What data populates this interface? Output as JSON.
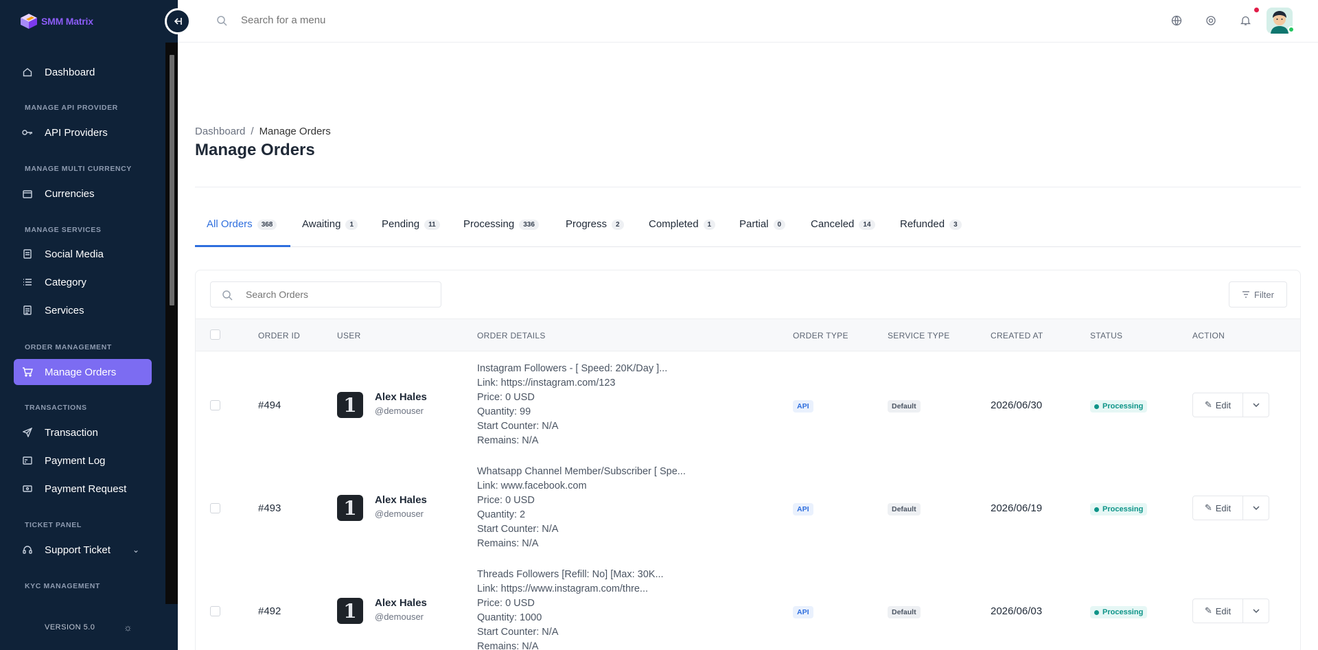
{
  "brand": {
    "name": "SMM Matrix",
    "accent": "#8b5cf6"
  },
  "sidebar": {
    "bg": "#0f2238",
    "sections": {
      "api": "MANAGE API PROVIDER",
      "currency": "MANAGE MULTI CURRENCY",
      "services": "MANAGE SERVICES",
      "orders": "ORDER MANAGEMENT",
      "transactions": "TRANSACTIONS",
      "tickets": "TICKET PANEL",
      "kyc": "KYC MANAGEMENT"
    },
    "items": {
      "dashboard": "Dashboard",
      "api_providers": "API Providers",
      "currencies": "Currencies",
      "social_media": "Social Media",
      "category": "Category",
      "services": "Services",
      "manage_orders": "Manage Orders",
      "transaction": "Transaction",
      "payment_log": "Payment Log",
      "payment_request": "Payment Request",
      "support_ticket": "Support Ticket"
    },
    "version": "VERSION 5.0"
  },
  "topbar": {
    "search_placeholder": "Search for a menu"
  },
  "breadcrumb": {
    "home": "Dashboard",
    "sep": "/",
    "current": "Manage Orders"
  },
  "page_title": "Manage Orders",
  "tabs": [
    {
      "label": "All Orders",
      "count": "368"
    },
    {
      "label": "Awaiting",
      "count": "1"
    },
    {
      "label": "Pending",
      "count": "11"
    },
    {
      "label": "Processing",
      "count": "336"
    },
    {
      "label": "Progress",
      "count": "2"
    },
    {
      "label": "Completed",
      "count": "1"
    },
    {
      "label": "Partial",
      "count": "0"
    },
    {
      "label": "Canceled",
      "count": "14"
    },
    {
      "label": "Refunded",
      "count": "3"
    }
  ],
  "table": {
    "search_placeholder": "Search Orders",
    "filter_label": "Filter",
    "headers": {
      "order_id": "ORDER ID",
      "user": "USER",
      "details": "ORDER DETAILS",
      "order_type": "ORDER TYPE",
      "service_type": "SERVICE TYPE",
      "created_at": "CREATED AT",
      "status": "STATUS",
      "action": "ACTION"
    },
    "edit_label": "Edit",
    "rows": [
      {
        "id": "#494",
        "user": "Alex Hales",
        "handle": "@demouser",
        "details": [
          "Instagram Followers - [ Speed: 20K/Day ]...",
          "Link: https://instagram.com/123",
          "Price: 0 USD",
          "Quantity: 99",
          "Start Counter: N/A",
          "Remains: N/A"
        ],
        "order_type": "API",
        "service_type": "Default",
        "created_at": "2026/06/30",
        "status": "Processing"
      },
      {
        "id": "#493",
        "user": "Alex Hales",
        "handle": "@demouser",
        "details": [
          "Whatsapp Channel Member/Subscriber [ Spe...",
          "Link: www.facebook.com",
          "Price: 0 USD",
          "Quantity: 2",
          "Start Counter: N/A",
          "Remains: N/A"
        ],
        "order_type": "API",
        "service_type": "Default",
        "created_at": "2026/06/19",
        "status": "Processing"
      },
      {
        "id": "#492",
        "user": "Alex Hales",
        "handle": "@demouser",
        "details": [
          "Threads Followers [Refill: No] [Max: 30K...",
          "Link: https://www.instagram.com/thre...",
          "Price: 0 USD",
          "Quantity: 1000",
          "Start Counter: N/A",
          "Remains: N/A"
        ],
        "order_type": "API",
        "service_type": "Default",
        "created_at": "2026/06/03",
        "status": "Processing"
      }
    ]
  }
}
